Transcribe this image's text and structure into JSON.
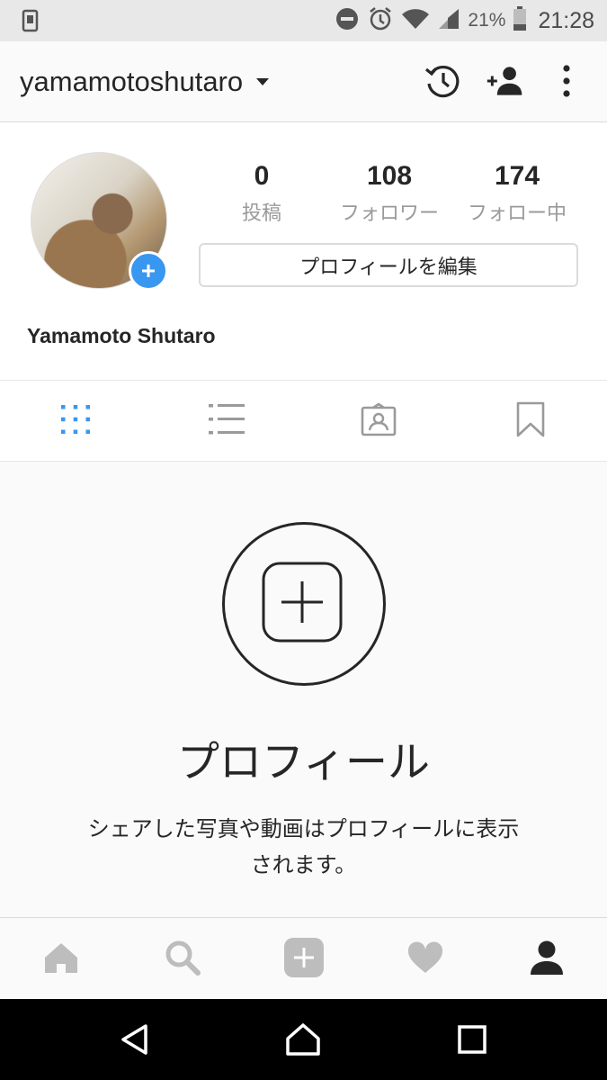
{
  "status_bar": {
    "left_icon": "screenshot-notification-icon",
    "icons": [
      "do-not-disturb-icon",
      "alarm-icon",
      "wifi-icon",
      "signal-icon"
    ],
    "battery_percent": "21%",
    "time": "21:28"
  },
  "top_bar": {
    "username": "yamamotoshutaro",
    "icons": [
      "chevron-down-icon",
      "history-icon",
      "add-person-icon",
      "more-vertical-icon"
    ]
  },
  "profile": {
    "avatar_icon": "avatar",
    "stats": [
      {
        "value": "0",
        "label": "投稿"
      },
      {
        "value": "108",
        "label": "フォロワー"
      },
      {
        "value": "174",
        "label": "フォロー中"
      }
    ],
    "edit_button": "プロフィールを編集",
    "full_name": "Yamamoto Shutaro"
  },
  "tabs": [
    {
      "icon": "grid-icon",
      "active": true
    },
    {
      "icon": "list-icon",
      "active": false
    },
    {
      "icon": "tagged-icon",
      "active": false
    },
    {
      "icon": "bookmark-icon",
      "active": false
    }
  ],
  "empty_state": {
    "icon": "add-post-icon",
    "title": "プロフィール",
    "description_line1": "シェアした写真や動画はプロフィールに表示",
    "description_line2": "されます。"
  },
  "bottom_nav": [
    "home-icon",
    "search-icon",
    "add-icon",
    "heart-icon",
    "profile-icon"
  ],
  "system_nav": [
    "back-icon",
    "home-nav-icon",
    "recents-icon"
  ],
  "colors": {
    "accent": "#3897f0",
    "text": "#262626",
    "muted": "#9a9a9a",
    "inactive_icon": "#bdbdbd"
  }
}
